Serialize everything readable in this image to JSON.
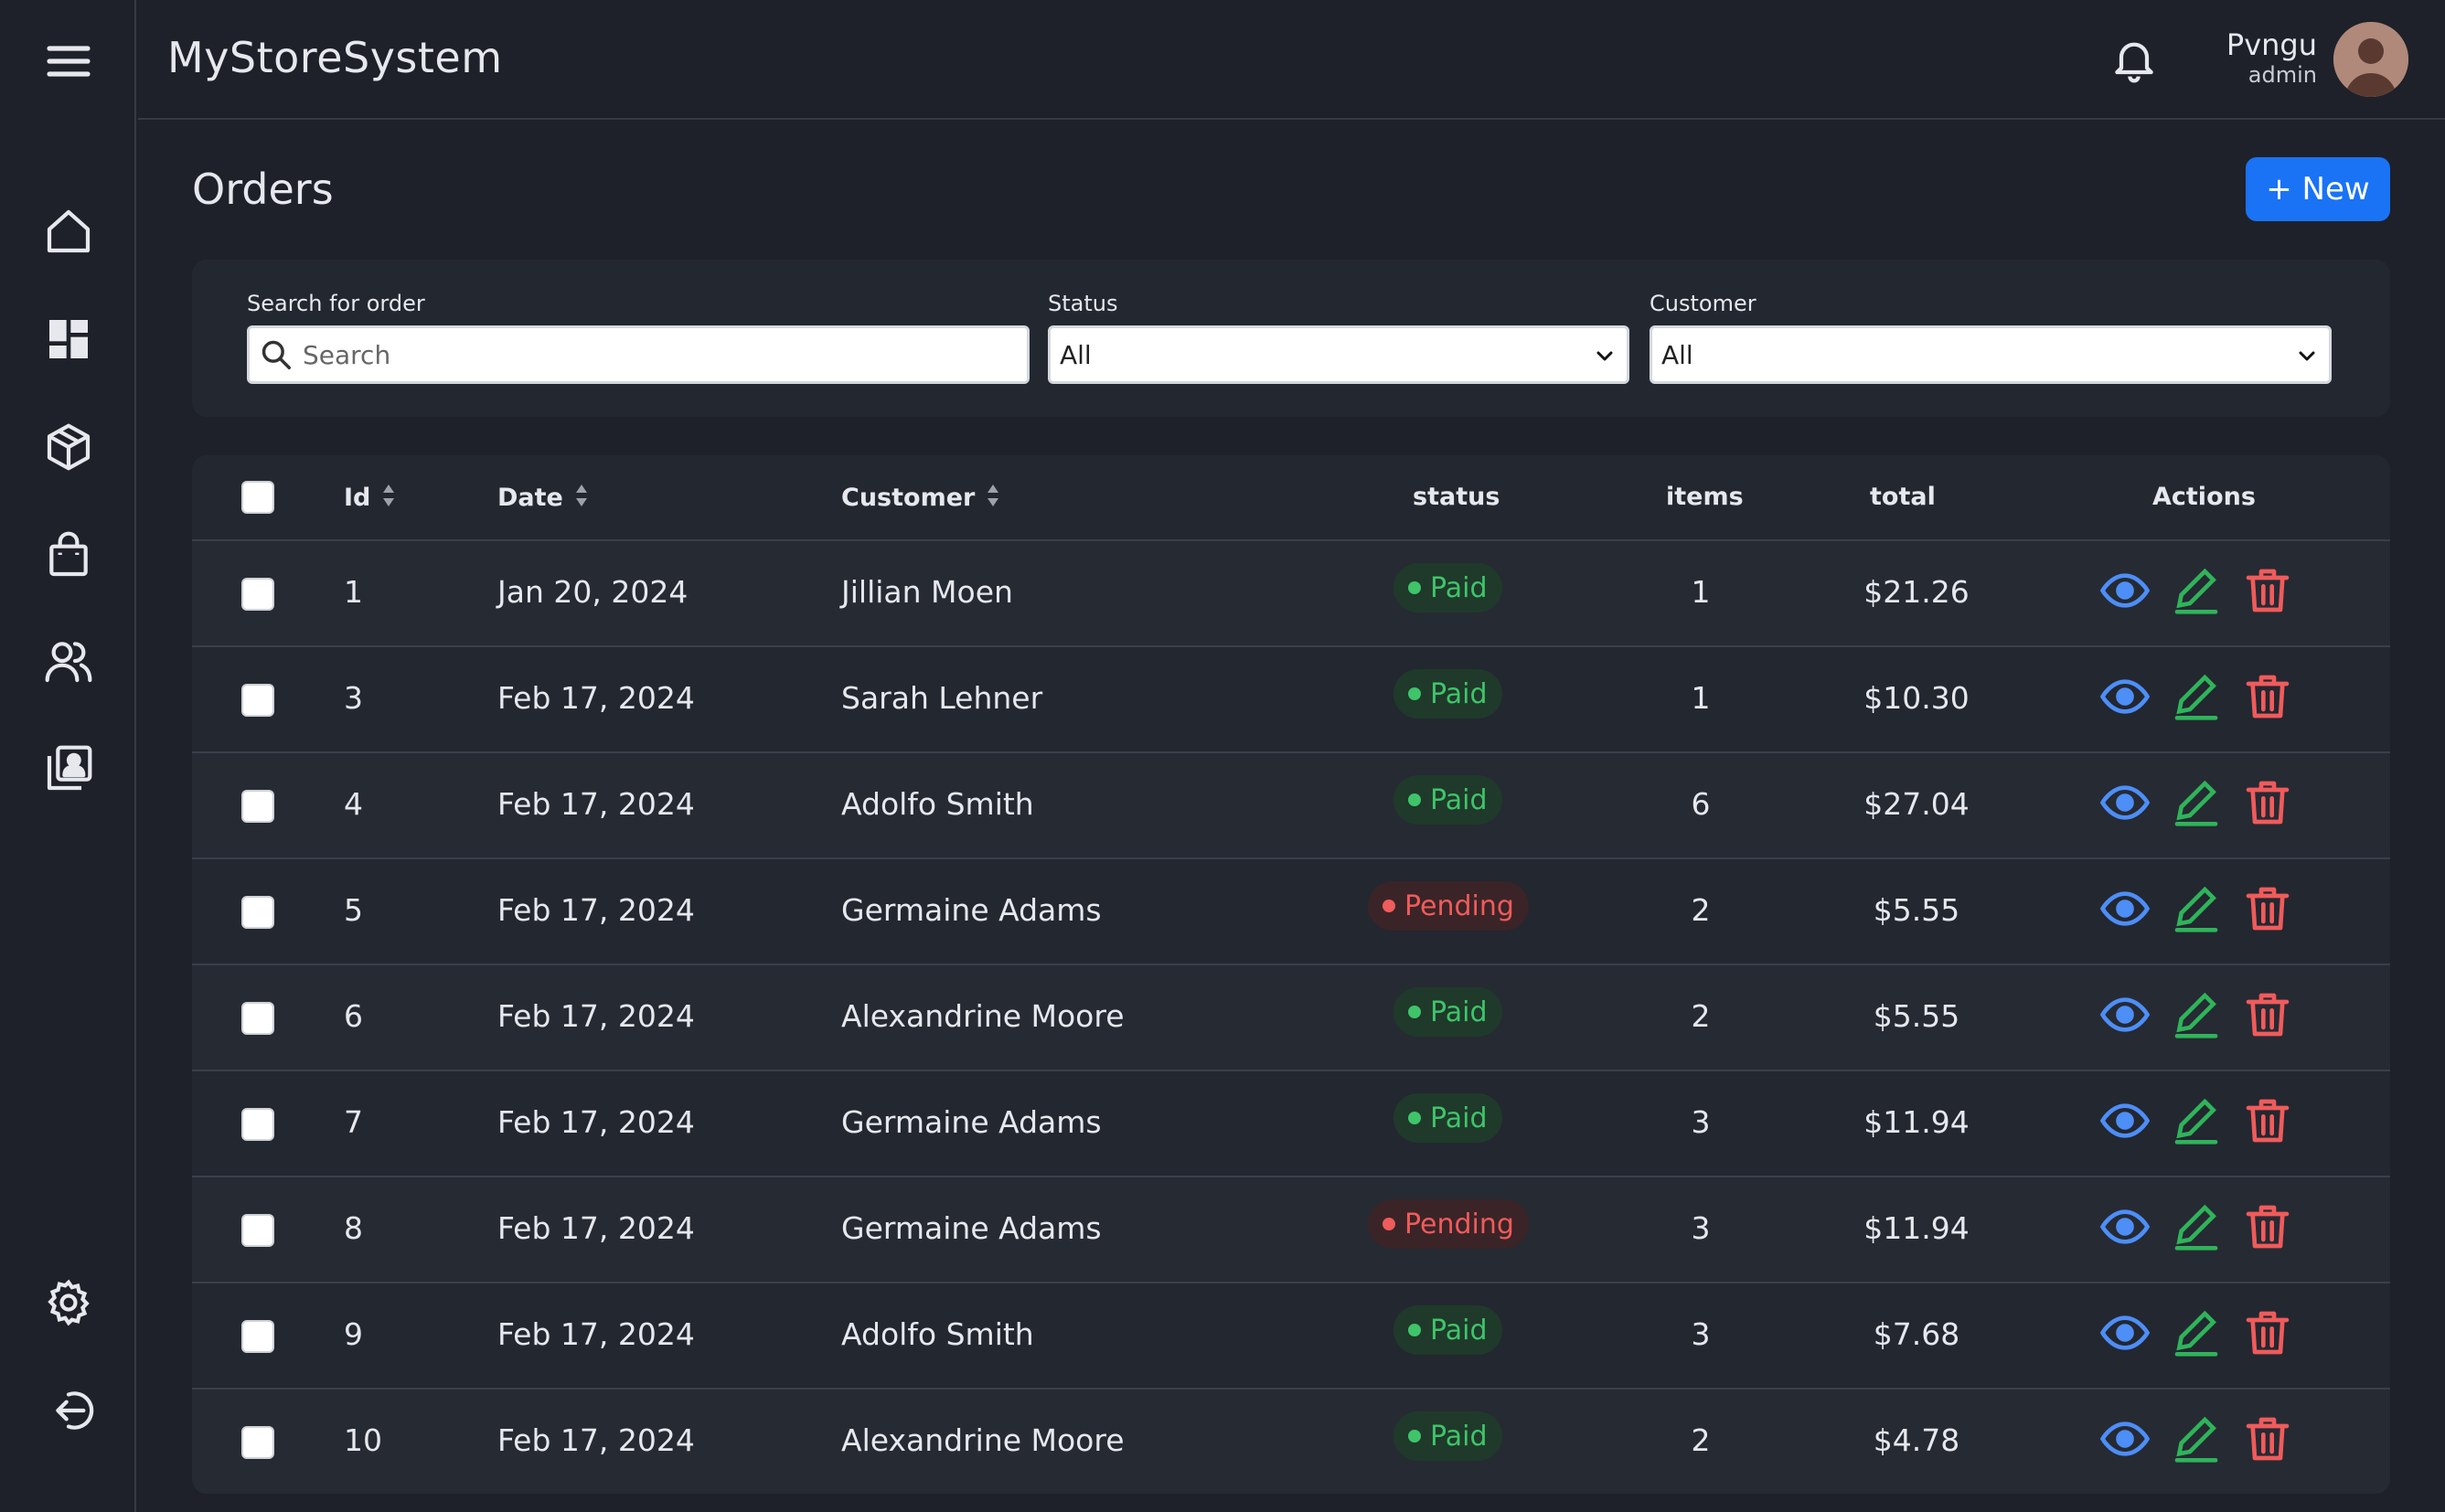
{
  "app": {
    "title": "MyStoreSystem"
  },
  "user": {
    "name": "Pvngu",
    "role": "admin"
  },
  "sidebar": {
    "top_icons": [
      "home-icon",
      "dashboard-icon",
      "products-box-icon",
      "shopping-bag-icon",
      "customers-icon",
      "contacts-icon"
    ],
    "bottom_icons": [
      "settings-gear-icon",
      "logout-icon"
    ]
  },
  "page": {
    "title": "Orders",
    "new_button": "+ New"
  },
  "filters": {
    "search_label": "Search for order",
    "search_placeholder": "Search",
    "status_label": "Status",
    "status_value": "All",
    "customer_label": "Customer",
    "customer_value": "All"
  },
  "table": {
    "columns": [
      "Id",
      "Date",
      "Customer",
      "status",
      "items",
      "total",
      "Actions"
    ],
    "rows": [
      {
        "id": "1",
        "date": "Jan 20, 2024",
        "customer": "Jillian Moen",
        "status": "Paid",
        "items": "1",
        "total": "$21.26"
      },
      {
        "id": "3",
        "date": "Feb 17, 2024",
        "customer": "Sarah Lehner",
        "status": "Paid",
        "items": "1",
        "total": "$10.30"
      },
      {
        "id": "4",
        "date": "Feb 17, 2024",
        "customer": "Adolfo Smith",
        "status": "Paid",
        "items": "6",
        "total": "$27.04"
      },
      {
        "id": "5",
        "date": "Feb 17, 2024",
        "customer": "Germaine Adams",
        "status": "Pending",
        "items": "2",
        "total": "$5.55"
      },
      {
        "id": "6",
        "date": "Feb 17, 2024",
        "customer": "Alexandrine Moore",
        "status": "Paid",
        "items": "2",
        "total": "$5.55"
      },
      {
        "id": "7",
        "date": "Feb 17, 2024",
        "customer": "Germaine Adams",
        "status": "Paid",
        "items": "3",
        "total": "$11.94"
      },
      {
        "id": "8",
        "date": "Feb 17, 2024",
        "customer": "Germaine Adams",
        "status": "Pending",
        "items": "3",
        "total": "$11.94"
      },
      {
        "id": "9",
        "date": "Feb 17, 2024",
        "customer": "Adolfo Smith",
        "status": "Paid",
        "items": "3",
        "total": "$7.68"
      },
      {
        "id": "10",
        "date": "Feb 17, 2024",
        "customer": "Alexandrine Moore",
        "status": "Paid",
        "items": "2",
        "total": "$4.78"
      }
    ]
  },
  "colors": {
    "background": "#1e2129",
    "card": "#232730",
    "accent": "#1a73f5",
    "paid": "#3fc46a",
    "pending": "#f05b5b",
    "view": "#4d8ef7",
    "edit": "#2fb45a",
    "delete": "#f05b5b"
  }
}
